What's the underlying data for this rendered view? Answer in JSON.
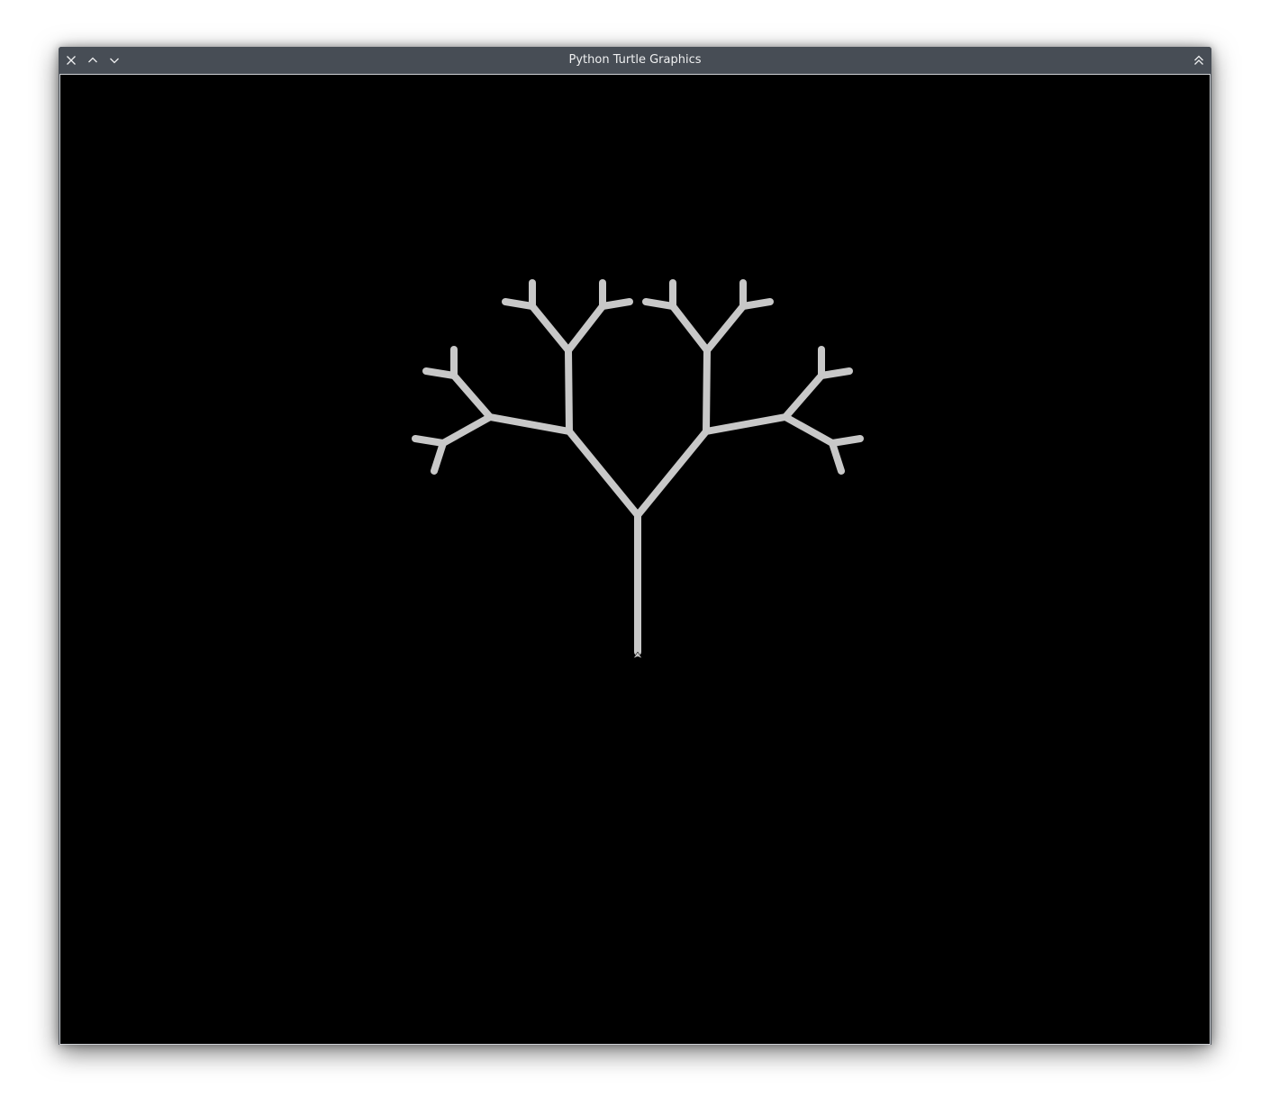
{
  "window": {
    "title": "Python Turtle Graphics",
    "buttons": {
      "close": "close-icon",
      "keep_above": "chevron-up-icon",
      "keep_below": "chevron-down-icon",
      "shade": "double-chevron-up-icon"
    }
  },
  "canvas": {
    "background": "#000000",
    "pen_color": "#c8c8c8",
    "turtle_icon": "turtle-arrow-icon"
  }
}
